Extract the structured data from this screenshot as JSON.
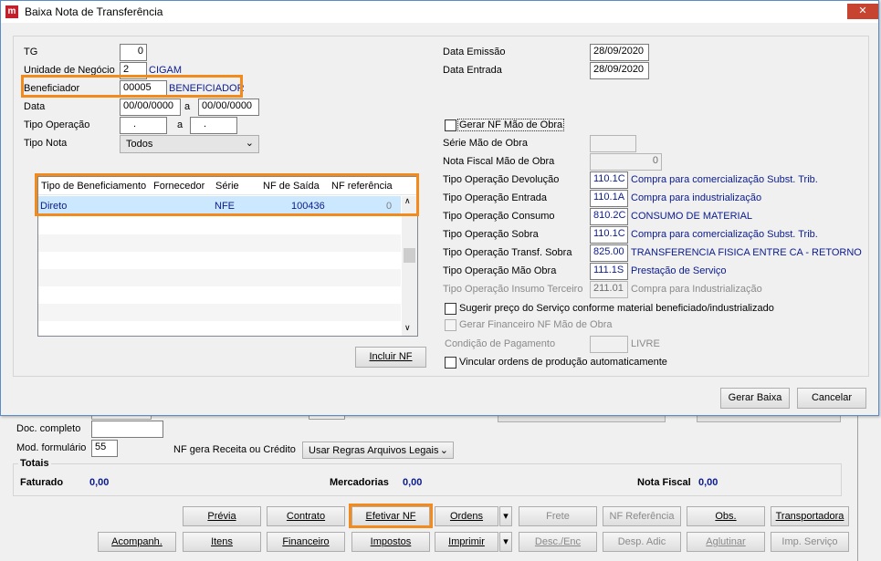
{
  "dialog": {
    "title": "Baixa Nota de Transferência",
    "close_glyph": "✕",
    "tg": {
      "label": "TG",
      "value": "0"
    },
    "unidade": {
      "label": "Unidade de Negócio",
      "code": "2",
      "name": "CIGAM"
    },
    "beneficiador": {
      "label": "Beneficiador",
      "code": "00005",
      "name": "BENEFICIADOR"
    },
    "data": {
      "label": "Data",
      "from": "00/00/0000",
      "sep": "a",
      "to": "00/00/0000"
    },
    "tipo_operacao": {
      "label": "Tipo Operação",
      "from": ".",
      "sep": "a",
      "to": "."
    },
    "tipo_nota": {
      "label": "Tipo Nota",
      "value": "Todos"
    },
    "grid": {
      "headers": [
        "Tipo de Beneficiamento",
        "Fornecedor",
        "Série",
        "NF de Saída",
        "NF referência"
      ],
      "rows": [
        {
          "tipo": "Direto",
          "fornecedor": "",
          "serie": "NFE",
          "nf_saida": "100436",
          "nf_ref": "0"
        }
      ]
    },
    "incluir_nf": "Incluir NF",
    "data_emissao": {
      "label": "Data Emissão",
      "value": "28/09/2020"
    },
    "data_entrada": {
      "label": "Data Entrada",
      "value": "28/09/2020"
    },
    "gerar_nf_mao_obra": {
      "label": "Gerar NF Mão de Obra",
      "checked": false
    },
    "serie_mao_obra": {
      "label": "Série Mão de Obra",
      "value": ""
    },
    "nf_mao_obra": {
      "label": "Nota Fiscal Mão de Obra",
      "value": "0"
    },
    "operacoes": [
      {
        "label": "Tipo Operação Devolução",
        "code": "110.1C",
        "desc": "Compra para comercialização Subst. Trib.",
        "disabled": false
      },
      {
        "label": "Tipo Operação Entrada",
        "code": "110.1A",
        "desc": "Compra para industrialização",
        "disabled": false
      },
      {
        "label": "Tipo Operação Consumo",
        "code": "810.2C",
        "desc": "CONSUMO DE MATERIAL",
        "disabled": false
      },
      {
        "label": "Tipo Operação Sobra",
        "code": "110.1C",
        "desc": "Compra para comercialização Subst. Trib.",
        "disabled": false
      },
      {
        "label": "Tipo Operação Transf. Sobra",
        "code": "825.00",
        "desc": "TRANSFERENCIA FISICA ENTRE CA - RETORNO",
        "disabled": false
      },
      {
        "label": "Tipo Operação Mão Obra",
        "code": "111.1S",
        "desc": "Prestação de Serviço",
        "disabled": false
      },
      {
        "label": "Tipo Operação Insumo Terceiro",
        "code": "211.01",
        "desc": "Compra para Industrialização",
        "disabled": true
      }
    ],
    "sugerir_preco": {
      "label": "Sugerir preço do Serviço conforme material beneficiado/industrializado",
      "checked": false
    },
    "gerar_financeiro": {
      "label": "Gerar Financeiro NF Mão de Obra",
      "checked": false
    },
    "condicao_pagamento": {
      "label": "Condição de Pagamento",
      "code": "",
      "desc": "LIVRE"
    },
    "vincular_ordens": {
      "label": "Vincular ordens de produção automaticamente",
      "checked": false
    },
    "gerar_baixa": "Gerar Baixa",
    "cancelar": "Cancelar"
  },
  "background": {
    "doc_completo": {
      "label": "Doc. completo",
      "value": ""
    },
    "mod_formulario": {
      "label": "Mod. formulário",
      "value": "55"
    },
    "nf_receita": {
      "label": "NF gera Receita ou Crédito",
      "value": "Usar Regras Arquivos Legais"
    },
    "totais": {
      "title": "Totais",
      "faturado": {
        "label": "Faturado",
        "value": "0,00"
      },
      "mercadorias": {
        "label": "Mercadorias",
        "value": "0,00"
      },
      "nota_fiscal": {
        "label": "Nota Fiscal",
        "value": "0,00"
      }
    },
    "buttons_row1": [
      "Prévia",
      "Contrato",
      "Efetivar NF",
      "Ordens",
      "Frete",
      "NF Referência",
      "Obs.",
      "Transportadora"
    ],
    "buttons_row2": [
      "Acompanh.",
      "Itens",
      "Financeiro",
      "Impostos",
      "Imprimir",
      "Desc./Enc",
      "Desp. Adic",
      "Aglutinar",
      "Imp. Serviço"
    ]
  },
  "colors": {
    "highlight": "#f28a1c",
    "selection": "#cce8ff",
    "value_text": "#0a1b8c"
  }
}
